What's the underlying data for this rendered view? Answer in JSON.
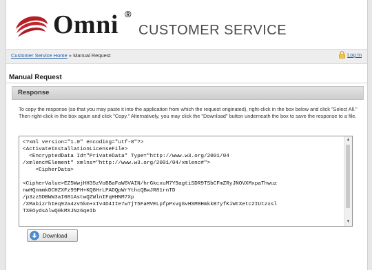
{
  "header": {
    "brand_name": "Omni",
    "registered_mark": "®",
    "service_title": "CUSTOMER SERVICE",
    "brand_color": "#b22026"
  },
  "breadcrumb": {
    "home_link": "Customer Service Home",
    "separator": "»",
    "current": "Manual Request"
  },
  "login": {
    "label": "Log In",
    "icon": "lock-icon"
  },
  "main": {
    "page_title": "Manual Request",
    "section_title": "Response",
    "instructions": "To copy the response (so that you may paste it into the application from which the request originated), right-click in the box below and click \"Select All.\" Then right-click in the box again and click \"Copy.\" Alternatively, you may click the \"Download\" button underneath the box to save the response to a file.",
    "response_text": "<?xml version=\"1.0\" encoding=\"utf-8\"?>\n<ActivateInstallationLicenseFile>\n  <EncryptedData Id=\"PrivateData\" Type=\"http://www.w3.org/2001/04\n/xmlenc#Element\" xmlns=\"http://www.w3.org/2001/04/xmlenc#\">\n    <CipherData>\n\n<CipherValue>EZ5WwjHH35zVoBBaFaW6VAIN/hrGkcxuM7Y9agtiSDR9TSbCFmZRyJNOVXMxpaThwuz\nnwHQnmmkDCHZXFz99PH+KQ8HrLPADQpWrYthcQBwJR81rnTD\n/p3zz5DBWW3aI081AstwQZWlnIFqHHNM7Xp\n/XMabizrhIeq92a4zv5km+xIv4D4IIe7wTjT5FaMVELpfpPxvgGvHSM8HmkkB7yfKiWtXetc2IUtzxsl\nTXEOydsAlwQ0kMXJNz6qeIb",
    "download_label": "Download",
    "download_icon": "download-icon"
  }
}
